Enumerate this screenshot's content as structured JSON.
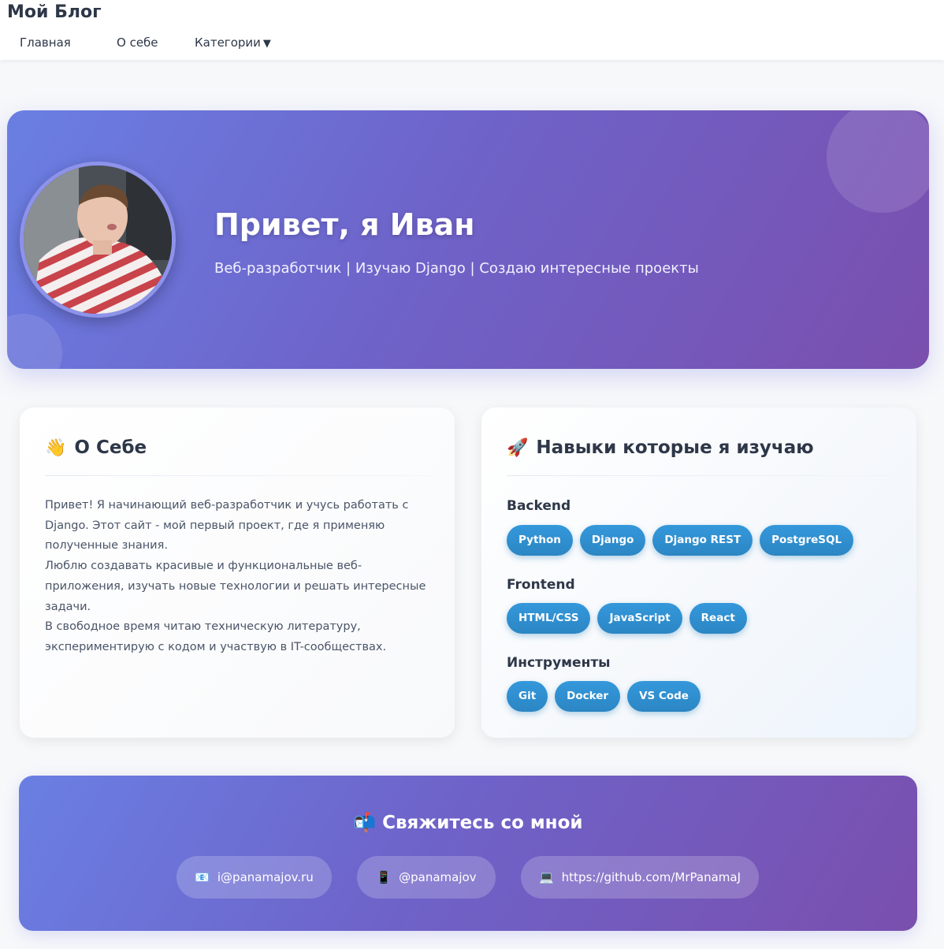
{
  "nav": {
    "brand": "Мой Блог",
    "items": [
      {
        "label": "Главная"
      },
      {
        "label": "О себе"
      },
      {
        "label": "Категории",
        "caret": "▼"
      }
    ]
  },
  "hero": {
    "title": "Привет, я Иван",
    "subtitle": "Веб-разработчик | Изучаю Django | Создаю интересные проекты"
  },
  "about": {
    "emoji": "👋",
    "title": "О Себе",
    "paragraphs": [
      "Привет! Я начинающий веб-разработчик и учусь работать с Django. Этот сайт - мой первый проект, где я применяю полученные знания.",
      "Люблю создавать красивые и функциональные веб-приложения, изучать новые технологии и решать интересные задачи.",
      "В свободное время читаю техническую литературу, экспериментирую с кодом и участвую в IT-сообществах."
    ]
  },
  "skills": {
    "emoji": "🚀",
    "title": "Навыки которые я изучаю",
    "groups": [
      {
        "name": "Backend",
        "items": [
          "Python",
          "Django",
          "Django REST",
          "PostgreSQL"
        ]
      },
      {
        "name": "Frontend",
        "items": [
          "HTML/CSS",
          "JavaScript",
          "React"
        ]
      },
      {
        "name": "Инструменты",
        "items": [
          "Git",
          "Docker",
          "VS Code"
        ]
      }
    ]
  },
  "contact": {
    "emoji": "📬",
    "title": "Свяжитесь со мной",
    "links": [
      {
        "icon": "📧",
        "icon_name": "email-icon",
        "label": "i@panamajov.ru"
      },
      {
        "icon": "📱",
        "icon_name": "phone-icon",
        "label": "@panamajov"
      },
      {
        "icon": "💻",
        "icon_name": "laptop-icon",
        "label": "https://github.com/MrPanamaJ"
      }
    ]
  },
  "colors": {
    "accent_gradient_start": "#6a7fe3",
    "accent_gradient_end": "#7a4fae",
    "skill_pill": "#3498db",
    "text_dark": "#2d3748"
  }
}
